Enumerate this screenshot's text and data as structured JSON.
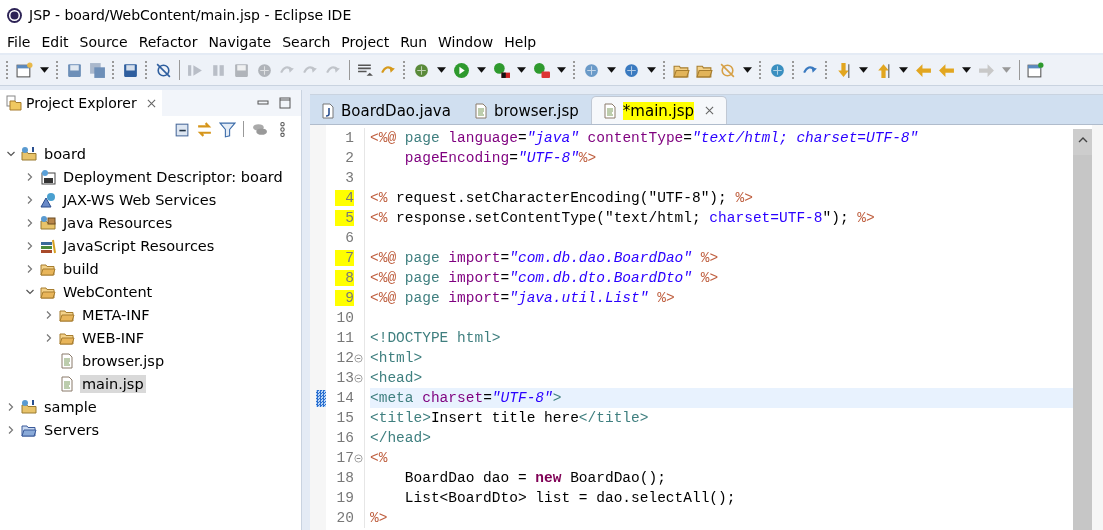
{
  "window": {
    "title": "JSP - board/WebContent/main.jsp - Eclipse IDE"
  },
  "menu": [
    "File",
    "Edit",
    "Source",
    "Refactor",
    "Navigate",
    "Search",
    "Project",
    "Run",
    "Window",
    "Help"
  ],
  "explorer": {
    "title": "Project Explorer",
    "tree": [
      {
        "label": "board",
        "kind": "project",
        "expanded": true,
        "selected": false,
        "children": [
          {
            "label": "Deployment Descriptor: board",
            "kind": "descriptor",
            "expanded": false,
            "selected": false
          },
          {
            "label": "JAX-WS Web Services",
            "kind": "webservice",
            "expanded": false,
            "selected": false
          },
          {
            "label": "Java Resources",
            "kind": "javares",
            "expanded": false,
            "selected": false
          },
          {
            "label": "JavaScript Resources",
            "kind": "jsres",
            "expanded": false,
            "selected": false
          },
          {
            "label": "build",
            "kind": "folder",
            "expanded": false,
            "selected": false
          },
          {
            "label": "WebContent",
            "kind": "folder",
            "expanded": true,
            "selected": false,
            "children": [
              {
                "label": "META-INF",
                "kind": "folder",
                "expanded": false,
                "selected": false
              },
              {
                "label": "WEB-INF",
                "kind": "folder",
                "expanded": false,
                "selected": false
              },
              {
                "label": "browser.jsp",
                "kind": "file",
                "selected": false
              },
              {
                "label": "main.jsp",
                "kind": "file",
                "selected": true
              }
            ]
          }
        ]
      },
      {
        "label": "sample",
        "kind": "project",
        "expanded": false,
        "selected": false
      },
      {
        "label": "Servers",
        "kind": "servers",
        "expanded": false,
        "selected": false
      }
    ]
  },
  "editor": {
    "tabs": [
      {
        "label": "BoardDao.java",
        "kind": "java",
        "selected": false,
        "highlighted": false
      },
      {
        "label": "browser.jsp",
        "kind": "file",
        "selected": false,
        "highlighted": false
      },
      {
        "label": "*main.jsp",
        "kind": "file",
        "selected": true,
        "highlighted": true
      }
    ],
    "lines": [
      {
        "number": "1",
        "highlighted": false,
        "current": false,
        "foldable": false,
        "tokens": [
          {
            "kind": "delim",
            "t": "<%@"
          },
          {
            "kind": "directive",
            "t": " page "
          },
          {
            "kind": "attr",
            "t": "language"
          },
          {
            "kind": "plain",
            "t": "="
          },
          {
            "kind": "value",
            "t": "\"java\""
          },
          {
            "kind": "attr",
            "t": " contentType"
          },
          {
            "kind": "plain",
            "t": "="
          },
          {
            "kind": "value",
            "t": "\"text/html; charset=UTF-8\""
          }
        ]
      },
      {
        "number": "2",
        "highlighted": false,
        "current": false,
        "foldable": false,
        "tokens": [
          {
            "kind": "attr",
            "t": "    pageEncoding"
          },
          {
            "kind": "plain",
            "t": "="
          },
          {
            "kind": "value",
            "t": "\"UTF-8\""
          },
          {
            "kind": "delim",
            "t": "%>"
          }
        ]
      },
      {
        "number": "3",
        "highlighted": false,
        "current": false,
        "foldable": false
      },
      {
        "number": "4",
        "highlighted": true,
        "current": false,
        "foldable": false,
        "tokens": [
          {
            "kind": "delim",
            "t": "<%"
          },
          {
            "kind": "java",
            "t": " request.setCharacterEncoding(\"UTF-8\"); "
          },
          {
            "kind": "delim",
            "t": "%>"
          }
        ]
      },
      {
        "number": "5",
        "highlighted": true,
        "current": false,
        "foldable": false,
        "tokens": [
          {
            "kind": "delim",
            "t": "<%"
          },
          {
            "kind": "java",
            "t": " response.setContentType(\"text/html;"
          },
          {
            "kind": "jstring",
            "t": " charset=UTF-8"
          },
          {
            "kind": "java",
            "t": "\"); "
          },
          {
            "kind": "delim",
            "t": "%>"
          }
        ]
      },
      {
        "number": "6",
        "highlighted": false,
        "current": false,
        "foldable": false
      },
      {
        "number": "7",
        "highlighted": true,
        "current": false,
        "foldable": false,
        "tokens": [
          {
            "kind": "delim",
            "t": "<%@"
          },
          {
            "kind": "directive",
            "t": " page "
          },
          {
            "kind": "attr",
            "t": "import"
          },
          {
            "kind": "plain",
            "t": "="
          },
          {
            "kind": "value",
            "t": "\"com.db.dao.BoardDao\""
          },
          {
            "kind": "delim",
            "t": " %>"
          }
        ]
      },
      {
        "number": "8",
        "highlighted": true,
        "current": false,
        "foldable": false,
        "tokens": [
          {
            "kind": "delim",
            "t": "<%@"
          },
          {
            "kind": "directive",
            "t": " page "
          },
          {
            "kind": "attr",
            "t": "import"
          },
          {
            "kind": "plain",
            "t": "="
          },
          {
            "kind": "value",
            "t": "\"com.db.dto.BoardDto\""
          },
          {
            "kind": "delim",
            "t": " %>"
          }
        ]
      },
      {
        "number": "9",
        "highlighted": true,
        "current": false,
        "foldable": false,
        "tokens": [
          {
            "kind": "delim",
            "t": "<%@"
          },
          {
            "kind": "directive",
            "t": " page "
          },
          {
            "kind": "attr",
            "t": "import"
          },
          {
            "kind": "plain",
            "t": "="
          },
          {
            "kind": "value",
            "t": "\"java.util.List\""
          },
          {
            "kind": "delim",
            "t": " %>"
          }
        ]
      },
      {
        "number": "10",
        "highlighted": false,
        "current": false,
        "foldable": false
      },
      {
        "number": "11",
        "highlighted": false,
        "current": false,
        "foldable": false,
        "tokens": [
          {
            "kind": "html",
            "t": "<!DOCTYPE html>"
          }
        ]
      },
      {
        "number": "12",
        "highlighted": false,
        "current": false,
        "foldable": true,
        "tokens": [
          {
            "kind": "html",
            "t": "<html>"
          }
        ]
      },
      {
        "number": "13",
        "highlighted": false,
        "current": false,
        "foldable": true,
        "tokens": [
          {
            "kind": "html",
            "t": "<head>"
          }
        ]
      },
      {
        "number": "14",
        "highlighted": false,
        "current": true,
        "foldable": false,
        "tokens": [
          {
            "kind": "html",
            "t": "<meta"
          },
          {
            "kind": "attr",
            "t": " charset"
          },
          {
            "kind": "plain",
            "t": "="
          },
          {
            "kind": "value",
            "t": "\"UTF-8\""
          },
          {
            "kind": "html",
            "t": ">"
          }
        ]
      },
      {
        "number": "15",
        "highlighted": false,
        "current": false,
        "foldable": false,
        "tokens": [
          {
            "kind": "html",
            "t": "<title>"
          },
          {
            "kind": "plain",
            "t": "Insert title here"
          },
          {
            "kind": "html",
            "t": "</title>"
          }
        ]
      },
      {
        "number": "16",
        "highlighted": false,
        "current": false,
        "foldable": false,
        "tokens": [
          {
            "kind": "html",
            "t": "</head>"
          }
        ]
      },
      {
        "number": "17",
        "highlighted": false,
        "current": false,
        "foldable": true,
        "tokens": [
          {
            "kind": "delim",
            "t": "<%"
          }
        ]
      },
      {
        "number": "18",
        "highlighted": false,
        "current": false,
        "foldable": false,
        "tokens": [
          {
            "kind": "java",
            "t": "    BoardDao dao = "
          },
          {
            "kind": "kw",
            "t": "new"
          },
          {
            "kind": "java",
            "t": " BoardDao();"
          }
        ]
      },
      {
        "number": "19",
        "highlighted": false,
        "current": false,
        "foldable": false,
        "tokens": [
          {
            "kind": "java",
            "t": "    List<BoardDto> list = dao.selectAll();"
          }
        ]
      },
      {
        "number": "20",
        "highlighted": false,
        "current": false,
        "foldable": false,
        "tokens": [
          {
            "kind": "delim",
            "t": "%>"
          }
        ]
      }
    ]
  }
}
